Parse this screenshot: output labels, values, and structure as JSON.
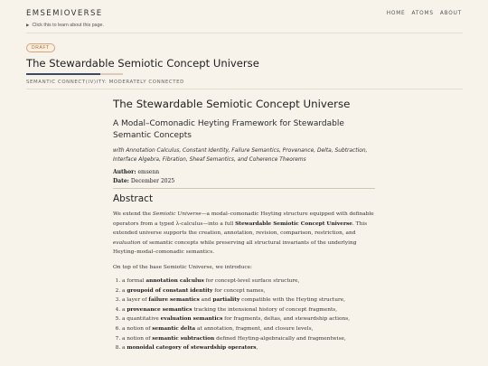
{
  "header": {
    "site_title": "EMSEMIOVERSE",
    "nav": [
      "HOME",
      "ATOMS",
      "ABOUT"
    ],
    "learn_text": "Click this to learn about this page."
  },
  "badge": "DRAFT",
  "page": {
    "title": "The Stewardable Semiotic Concept Universe",
    "meta": "SEMANTIC CONNECT(IV)ITY: MODERATELY CONNECTED"
  },
  "article": {
    "title": "The Stewardable Semiotic Concept Universe",
    "subtitle": "A Modal–Comonadic Heyting Framework for Stewardable Semantic Concepts",
    "with_line": "with Annotation Calculus, Constant Identity, Failure Semantics, Provenance, Delta, Subtraction, Interface Algebra, Fibration, Sheaf Semantics, and Coherence Theorems",
    "author_label": "Author:",
    "author": "emsenn",
    "date_label": "Date:",
    "date": "December 2025",
    "abstract_heading": "Abstract",
    "abstract_p1": {
      "a": "We extend the ",
      "b": "Semiotic Universe",
      "c": "—a modal–comonadic Heyting structure equipped with definable operators from a typed λ-calculus—into a full ",
      "d": "Stewardable Semiotic Concept Universe",
      "e": ". This extended universe supports the creation, annotation, revision, comparison, restriction, and ",
      "f": "evaluation",
      "g": " of semantic concepts while preserving all structural invariants of the underlying Heyting–modal–comonadic semantics."
    },
    "abstract_p2": "On top of the base Semiotic Universe, we introduce:",
    "contributions": [
      {
        "pre": "a formal ",
        "bold": "annotation calculus",
        "post": " for concept-level surface structure,"
      },
      {
        "pre": "a ",
        "bold": "groupoid of constant identity",
        "post": " for concept names,"
      },
      {
        "pre": "a layer of ",
        "bold": "failure semantics",
        "post": " and ",
        "bold2": "partiality",
        "post2": " compatible with the Heyting structure,"
      },
      {
        "pre": "a ",
        "bold": "provenance semantics",
        "post": " tracking the intensional history of concept fragments,"
      },
      {
        "pre": "a quantitative ",
        "bold": "evaluation semantics",
        "post": " for fragments, deltas, and stewardship actions,"
      },
      {
        "pre": "a notion of ",
        "bold": "semantic delta",
        "post": " at annotation, fragment, and closure levels,"
      },
      {
        "pre": "a notion of ",
        "bold": "semantic subtraction",
        "post": " defined Heyting-algebraically and fragmentwise,"
      },
      {
        "pre": "a ",
        "bold": "monoidal category of stewardship operators",
        "post": ","
      }
    ]
  },
  "colors": {
    "background": "#f7f3eb",
    "accent": "#3b4a6b",
    "badge": "#b06a3a"
  }
}
